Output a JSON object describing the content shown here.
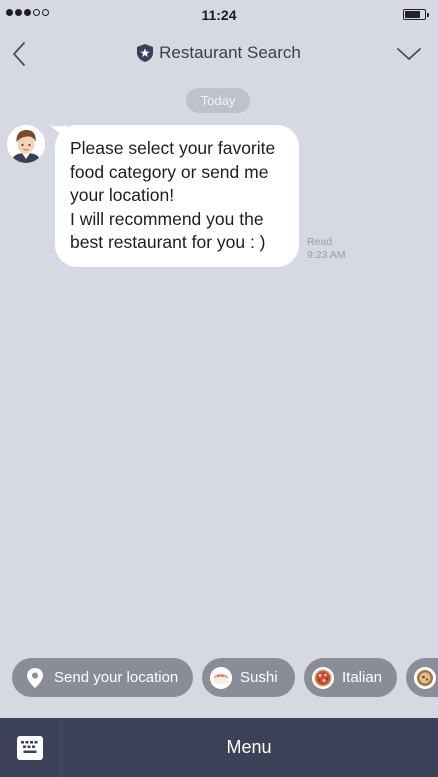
{
  "status_bar": {
    "time": "11:24",
    "signal_bars_filled": 3,
    "signal_bars_total": 5
  },
  "nav": {
    "title": "Restaurant Search",
    "back_icon": "chevron-left-icon",
    "title_icon": "shield-star-icon",
    "dropdown_icon": "chevron-down-icon"
  },
  "chat": {
    "date_label": "Today",
    "messages": [
      {
        "text": "Please select your favorite food category or send me your location!\nI will recommend you the best restaurant for you : )",
        "read_label": "Read",
        "time": "9:23 AM"
      }
    ]
  },
  "quick_replies": [
    {
      "label": "Send your location",
      "icon": "location-pin-icon"
    },
    {
      "label": "Sushi",
      "icon": "sushi-icon"
    },
    {
      "label": "Italian",
      "icon": "pizza-icon"
    },
    {
      "label": "",
      "icon": "food-icon"
    }
  ],
  "bottom": {
    "menu_label": "Menu",
    "keyboard_icon": "keyboard-icon"
  },
  "colors": {
    "background": "#d7d9e2",
    "bottom_bar": "#3d4157",
    "chip": "#8a8d98",
    "title": "#3a3d4d"
  }
}
